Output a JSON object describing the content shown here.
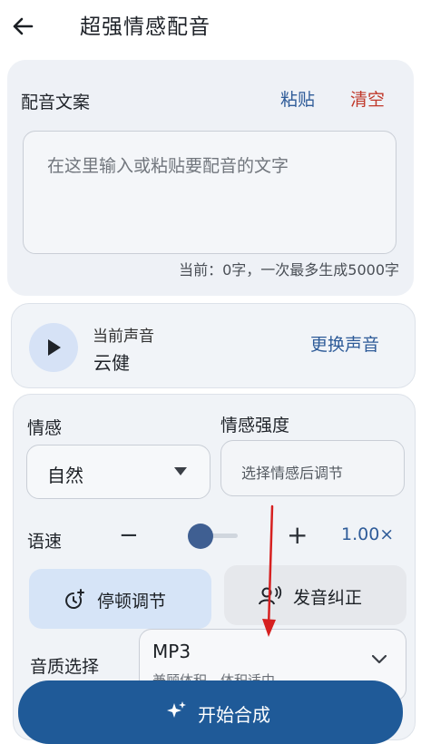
{
  "header": {
    "title": "超强情感配音",
    "back_icon": "arrow-left-icon"
  },
  "script_section": {
    "label": "配音文案",
    "paste": "粘贴",
    "clear": "清空",
    "placeholder": "在这里输入或粘贴要配音的文字",
    "counter": "当前：0字，一次最多生成5000字"
  },
  "voice": {
    "caption": "当前声音",
    "name": "云健",
    "change": "更换声音",
    "play_icon": "play-icon"
  },
  "emotion": {
    "label": "情感",
    "value": "自然",
    "intensity_label": "情感强度",
    "intensity_placeholder": "选择情感后调节"
  },
  "speed": {
    "label": "语速",
    "minus": "−",
    "plus": "+",
    "value": "1.00×",
    "level": 0.2
  },
  "actions": {
    "pause": "停顿调节",
    "pronounce": "发音纠正"
  },
  "quality": {
    "label": "音质选择",
    "value": "MP3",
    "hint": "兼顾体积，体积适中"
  },
  "primary": {
    "label": "开始合成",
    "icon": "sparkle-icon"
  },
  "colors": {
    "accent": "#1f5a98",
    "danger": "#c0392b",
    "link": "#2f5c99",
    "annotation": "#d62020"
  }
}
